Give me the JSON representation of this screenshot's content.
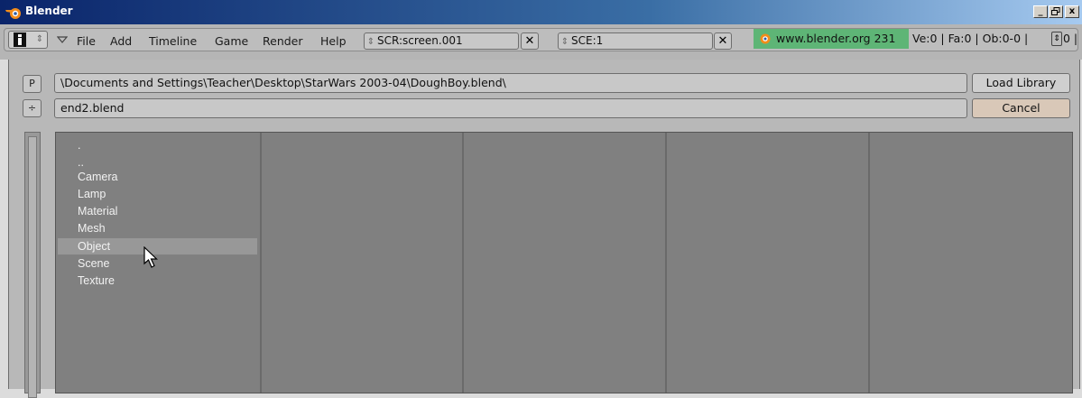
{
  "window": {
    "title": "Blender",
    "controls": [
      "_",
      "▫",
      "x"
    ]
  },
  "header": {
    "menus": [
      "File",
      "Add",
      "Timeline",
      "Game",
      "Render",
      "Help"
    ],
    "screen_field": "SCR:screen.001",
    "scene_field": "SCE:1",
    "info_text": "www.blender.org 231",
    "stats": "Ve:0 | Fa:0 | Ob:0-0 |",
    "stats_tail": "0 |",
    "colors": {
      "info_bg": "#5eb576",
      "bar_bg": "#b5b5b5"
    }
  },
  "file_browser": {
    "parent_button": "P",
    "menu_button": "÷",
    "directory": "\\Documents and Settings\\Teacher\\Desktop\\StarWars 2003-04\\DoughBoy.blend\\",
    "filename": "end2.blend",
    "load_button": "Load Library",
    "cancel_button": "Cancel",
    "items": [
      ".",
      "..",
      "Camera",
      "Lamp",
      "Material",
      "Mesh",
      "Object",
      "Scene",
      "Texture"
    ],
    "selected_item": "Object"
  }
}
